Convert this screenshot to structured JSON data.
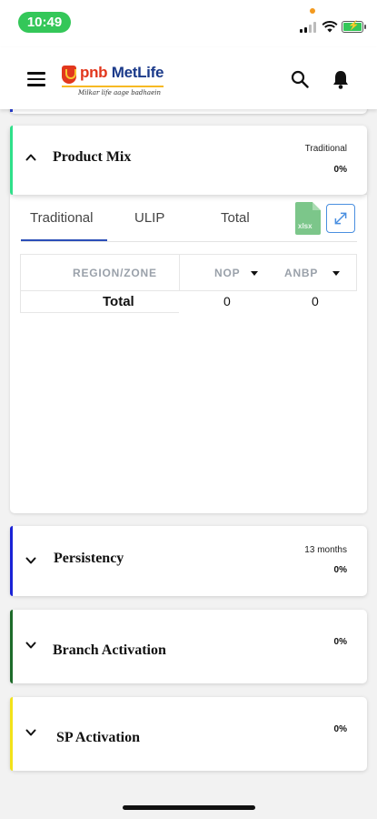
{
  "status_bar": {
    "time": "10:49"
  },
  "header": {
    "brand_pnb": "pnb",
    "brand_metlife": "MetLife",
    "tagline": "Milkar life aage badhaein"
  },
  "product_mix": {
    "title": "Product Mix",
    "sublabel": "Traditional",
    "percent": "0%",
    "accent_color": "#2fe08a",
    "tabs": [
      {
        "label": "Traditional",
        "active": true
      },
      {
        "label": "ULIP",
        "active": false
      },
      {
        "label": "Total",
        "active": false
      }
    ],
    "export_label": "xlsx",
    "table": {
      "headers": [
        "REGION/ZONE",
        "NOP",
        "ANBP"
      ],
      "rows": [
        {
          "label": "Total",
          "nop": "0",
          "anbp": "0"
        }
      ]
    }
  },
  "cards": [
    {
      "title": "Persistency",
      "sublabel": "13 months",
      "percent": "0%",
      "accent_color": "#1a22d6"
    },
    {
      "title": "Branch Activation",
      "sublabel": "",
      "percent": "0%",
      "accent_color": "#1e6b2a"
    },
    {
      "title": "SP Activation",
      "sublabel": "",
      "percent": "0%",
      "accent_color": "#f2e21a"
    }
  ],
  "colors": {
    "prev_card_accent": "#2b3fd1",
    "tab_indicator": "#2b4fb8",
    "time_pill": "#34c759"
  }
}
